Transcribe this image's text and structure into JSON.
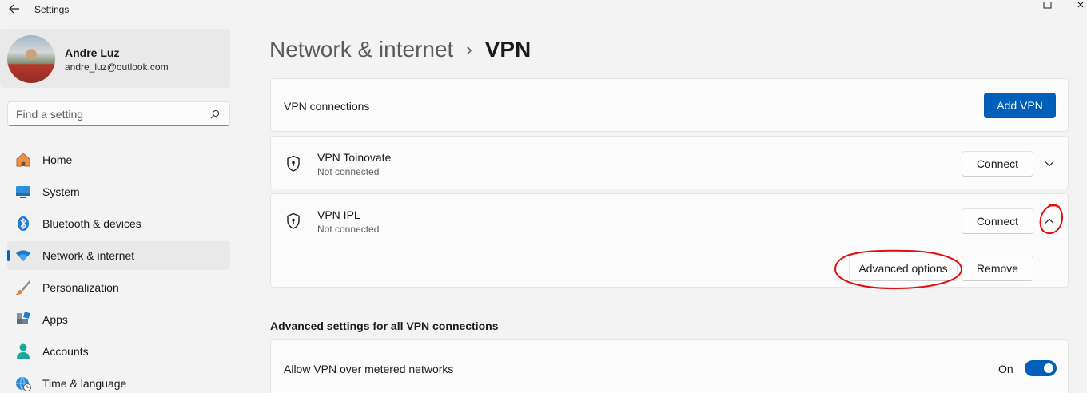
{
  "window": {
    "title": "Settings"
  },
  "profile": {
    "name": "Andre Luz",
    "email": "andre_luz@outlook.com"
  },
  "search": {
    "placeholder": "Find a setting"
  },
  "nav": {
    "items": [
      {
        "label": "Home",
        "icon": "home-icon"
      },
      {
        "label": "System",
        "icon": "monitor-icon"
      },
      {
        "label": "Bluetooth & devices",
        "icon": "bluetooth-icon"
      },
      {
        "label": "Network & internet",
        "icon": "wifi-icon",
        "active": true
      },
      {
        "label": "Personalization",
        "icon": "brush-icon"
      },
      {
        "label": "Apps",
        "icon": "apps-icon"
      },
      {
        "label": "Accounts",
        "icon": "person-icon"
      },
      {
        "label": "Time & language",
        "icon": "globe-clock-icon"
      }
    ]
  },
  "breadcrumb": {
    "parent": "Network & internet",
    "separator": "›",
    "current": "VPN"
  },
  "vpn_connections": {
    "title": "VPN connections",
    "add_label": "Add VPN"
  },
  "vpns": [
    {
      "name": "VPN Toinovate",
      "status": "Not connected",
      "connect_label": "Connect",
      "expanded": false
    },
    {
      "name": "VPN IPL",
      "status": "Not connected",
      "connect_label": "Connect",
      "expanded": true,
      "advanced_label": "Advanced options",
      "remove_label": "Remove"
    }
  ],
  "advanced": {
    "heading": "Advanced settings for all VPN connections",
    "metered_label": "Allow VPN over metered networks",
    "metered_state": "On",
    "metered_on": true
  },
  "colors": {
    "accent": "#005fb8",
    "annotation": "#e01010"
  }
}
